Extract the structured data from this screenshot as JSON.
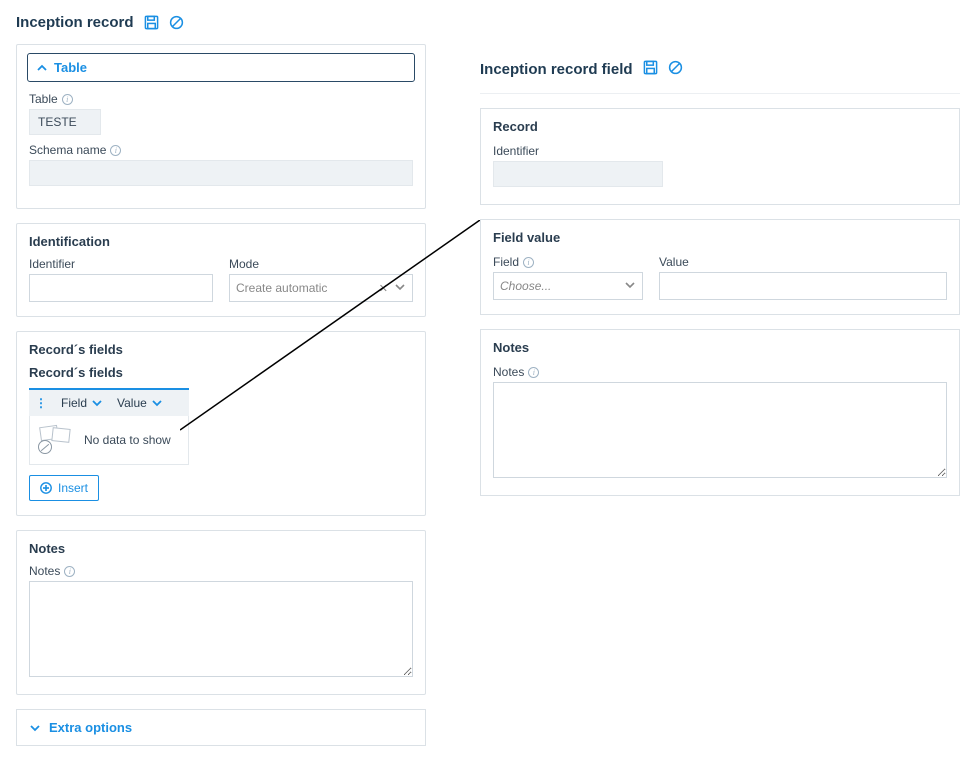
{
  "left": {
    "title": "Inception record",
    "table_section": {
      "header": "Table",
      "labels": {
        "table": "Table",
        "schema": "Schema name"
      },
      "values": {
        "table": "TESTE",
        "schema": ""
      }
    },
    "identification_section": {
      "header": "Identification",
      "labels": {
        "identifier": "Identifier",
        "mode": "Mode"
      },
      "values": {
        "identifier": "",
        "mode": "Create automatic"
      }
    },
    "records_fields_section": {
      "header": "Record´s fields",
      "subheader": "Record´s fields",
      "columns": {
        "field": "Field",
        "value": "Value"
      },
      "no_data": "No data to show",
      "insert_label": "Insert"
    },
    "notes_section": {
      "header": "Notes",
      "label": "Notes",
      "value": ""
    },
    "extra_options": {
      "label": "Extra options"
    }
  },
  "right": {
    "title": "Inception record field",
    "record_section": {
      "header": "Record",
      "labels": {
        "identifier": "Identifier"
      },
      "values": {
        "identifier": ""
      }
    },
    "field_value_section": {
      "header": "Field value",
      "labels": {
        "field": "Field",
        "value": "Value"
      },
      "values": {
        "field_placeholder": "Choose...",
        "value": ""
      }
    },
    "notes_section": {
      "header": "Notes",
      "label": "Notes",
      "value": ""
    }
  }
}
